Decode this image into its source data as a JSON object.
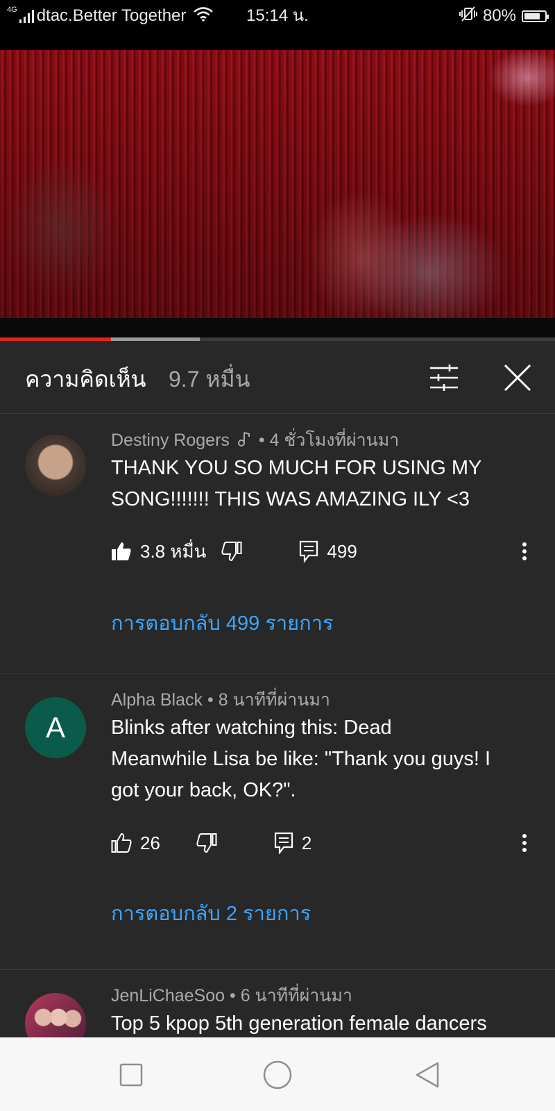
{
  "status_bar": {
    "network_type": "4G",
    "carrier": "dtac.Better Together",
    "time": "15:14 น.",
    "battery_percent": "80%",
    "battery_level": 0.8
  },
  "video": {
    "played_fraction": 0.2,
    "buffered_fraction": 0.36
  },
  "comments_header": {
    "title": "ความคิดเห็น",
    "count": "9.7 หมื่น",
    "filter_icon": "sliders-icon",
    "close_icon": "close-icon"
  },
  "comments": [
    {
      "author": "Destiny Rogers",
      "badge_icon": "music-note-icon",
      "time": "4 ชั่วโมงที่ผ่านมา",
      "text": "THANK YOU SO MUCH FOR USING MY SONG!!!!!!! THIS WAS AMAZING ILY <3",
      "likes": "3.8 หมื่น",
      "liked": true,
      "reply_count": "499",
      "replies_link": "การตอบกลับ 499 รายการ"
    },
    {
      "author": "Alpha Black",
      "avatar_letter": "A",
      "time": "8 นาทีที่ผ่านมา",
      "text": "Blinks after watching this: Dead\nMeanwhile Lisa be like: \"Thank you guys! I got your back, OK?\".",
      "likes": "26",
      "liked": false,
      "reply_count": "2",
      "replies_link": "การตอบกลับ 2 รายการ"
    },
    {
      "author": "JenLiChaeSoo",
      "time": "6 นาทีที่ผ่านมา",
      "text": "Top 5 kpop 5th generation female dancers"
    }
  ],
  "colors": {
    "background": "#282828",
    "link": "#3ea6ff",
    "progress_played": "#e62117",
    "avatar_alpha": "#0b5b4a"
  },
  "nav_bar": {
    "recents_icon": "square-icon",
    "home_icon": "circle-icon",
    "back_icon": "triangle-back-icon"
  }
}
